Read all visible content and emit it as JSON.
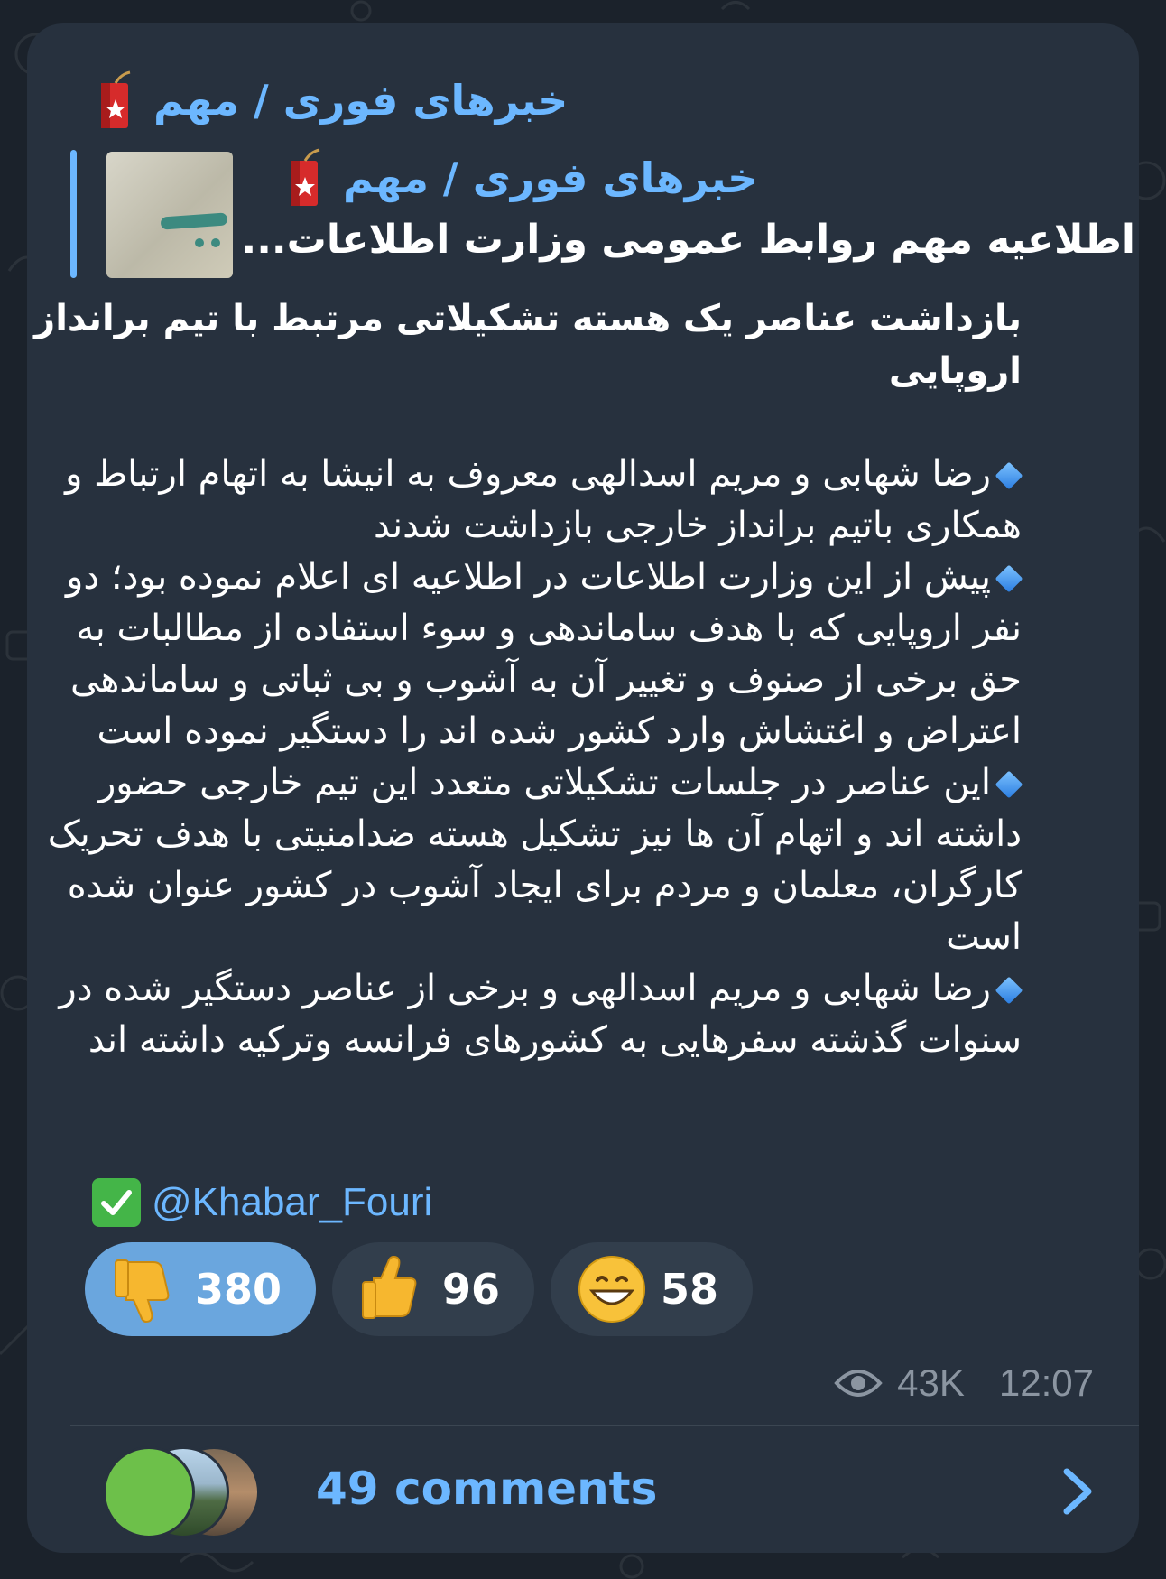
{
  "channel": {
    "name": "خبرهای فوری / مهم"
  },
  "reply": {
    "channel_name": "خبرهای فوری / مهم",
    "preview_text": "اطلاعیه مهم روابط عمومی وزارت اطلاعات..."
  },
  "post": {
    "headline": "بازداشت عناصر یک هسته تشکیلاتی مرتبط با تیم برانداز اروپایی",
    "paragraphs": [
      "رضا شهابی و مریم اسدالهی معروف به انیشا به اتهام ارتباط و همکاری باتیم برانداز خارجی بازداشت شدند",
      "پیش از این وزارت اطلاعات در اطلاعیه ای اعلام نموده بود؛ دو نفر اروپایی که با هدف ساماندهی و سوء استفاده از مطالبات به حق برخی از صنوف و تغییر آن به آشوب و بی ثباتی و ساماندهی اعتراض و اغتشاش وارد کشور شده اند را دستگیر نموده است",
      "این عناصر در جلسات تشکیلاتی متعدد این تیم خارجی حضور داشته اند و اتهام آن ها نیز تشکیل هسته ضدامنیتی با هدف تحریک کارگران، معلمان و مردم برای ایجاد آشوب در کشور عنوان شده است",
      "رضا شهابی و مریم اسدالهی و برخی از عناصر دستگیر شده در سنوات گذشته سفرهایی به کشورهای فرانسه وترکیه داشته اند"
    ],
    "handle": "@Khabar_Fouri"
  },
  "reactions": [
    {
      "emoji": "thumbs-down",
      "count": "380",
      "active": true
    },
    {
      "emoji": "thumbs-up",
      "count": "96",
      "active": false
    },
    {
      "emoji": "grinning-face",
      "count": "58",
      "active": false
    }
  ],
  "meta": {
    "views": "43K",
    "time": "12:07"
  },
  "comments": {
    "label": "49 comments"
  },
  "colors": {
    "background": "#1b222b",
    "card": "#27313e",
    "accent": "#6cb7ff",
    "reaction_active": "#6aa6de",
    "reaction": "#323e4c"
  }
}
